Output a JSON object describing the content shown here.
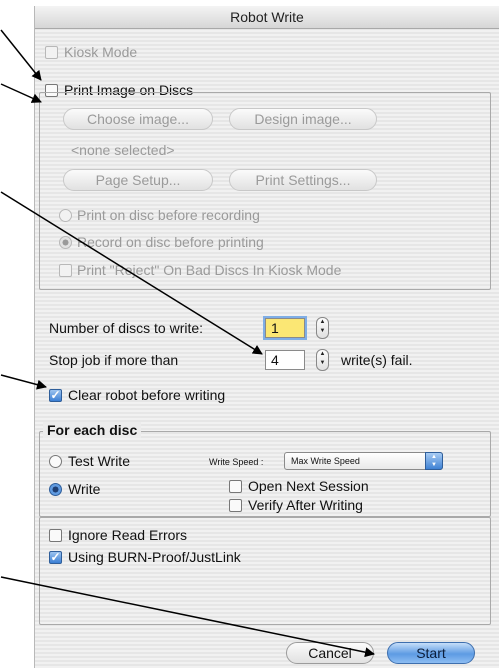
{
  "window": {
    "title": "Robot Write"
  },
  "options": {
    "kiosk_mode": "Kiosk Mode",
    "print_image": "Print Image on Discs"
  },
  "print_group": {
    "choose_image": "Choose image...",
    "design_image": "Design image...",
    "none_selected": "<none selected>",
    "page_setup": "Page Setup...",
    "print_settings": "Print Settings...",
    "print_before_recording": "Print on disc before recording",
    "record_before_printing": "Record on disc before printing",
    "print_reject": "Print \"Reject\" On Bad Discs In Kiosk Mode"
  },
  "job": {
    "num_discs_label": "Number of discs to write:",
    "num_discs_value": "1",
    "stop_job_label": "Stop job if more than",
    "stop_job_value": "4",
    "stop_job_suffix": "write(s) fail.",
    "clear_robot": "Clear robot before writing"
  },
  "each_disc": {
    "legend": "For each disc",
    "test_write": "Test Write",
    "write": "Write",
    "write_speed_label": "Write Speed :",
    "write_speed_value": "Max Write Speed",
    "open_next_session": "Open Next Session",
    "verify_after_writing": "Verify After Writing",
    "ignore_read_errors": "Ignore Read Errors",
    "burn_proof": "Using BURN-Proof/JustLink"
  },
  "buttons": {
    "cancel": "Cancel",
    "start": "Start"
  },
  "colors": {
    "default_button": "#5d9be3",
    "focus_field": "#fbe774",
    "annotation_arrow": "#000000"
  }
}
